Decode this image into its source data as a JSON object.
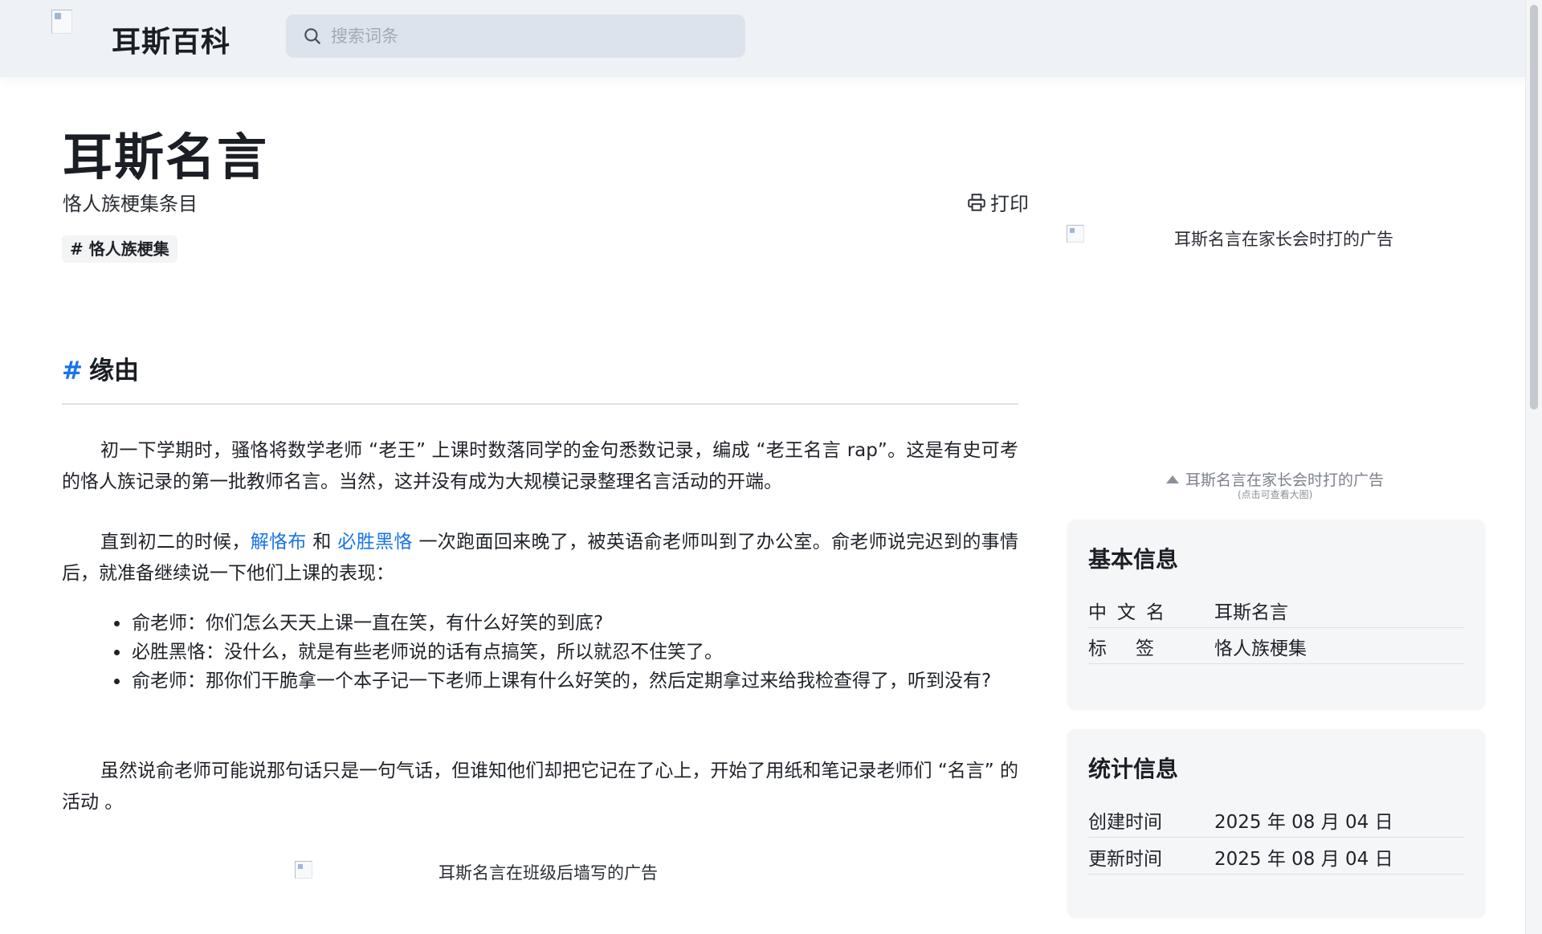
{
  "header": {
    "site_name": "耳斯百科",
    "search_placeholder": "搜索词条"
  },
  "article": {
    "title": "耳斯名言",
    "subtitle": "恪人族梗集条目",
    "print_label": "打印",
    "tag": "# 恪人族梗集",
    "section_title": "缘由",
    "para1": "初一下学期时，骚恪将数学老师 “老王” 上课时数落同学的金句悉数记录，编成 “老王名言 rap”。这是有史可考的恪人族记录的第一批教师名言。当然，这并没有成为大规模记录整理名言活动的开端。",
    "para2": {
      "lead": "直到初二的时候，",
      "link1": "解恪布",
      "and": " 和 ",
      "link2": "必胜黑恪",
      "rest": " 一次跑面回来晚了，被英语俞老师叫到了办公室。俞老师说完迟到的事情后，就准备继续说一下他们上课的表现："
    },
    "dialog": [
      "俞老师：你们怎么天天上课一直在笑，有什么好笑的到底?",
      "必胜黑恪：没什么，就是有些老师说的话有点搞笑，所以就忍不住笑了。",
      "俞老师：那你们干脆拿一个本子记一下老师上课有什么好笑的，然后定期拿过来给我检查得了，听到没有?"
    ],
    "para3": "虽然说俞老师可能说那句话只是一句气话，但谁知他们却把它记在了心上，开始了用纸和笔记录老师们 “名言” 的活动 。",
    "image2_alt": "耳斯名言在班级后墙写的广告"
  },
  "sidebar": {
    "image_alt": "耳斯名言在家长会时打的广告",
    "caption": "耳斯名言在家长会时打的广告",
    "caption_sub": "(点击可查看大图)",
    "basic_info": {
      "title": "基本信息",
      "rows": [
        {
          "key": "中文名",
          "value": "耳斯名言"
        },
        {
          "key": "标签",
          "value": "恪人族梗集"
        }
      ]
    },
    "stats": {
      "title": "统计信息",
      "rows": [
        {
          "key": "创建时间",
          "value": "2025 年 08 月 04 日"
        },
        {
          "key": "更新时间",
          "value": "2025 年 08 月 04 日"
        }
      ]
    }
  }
}
